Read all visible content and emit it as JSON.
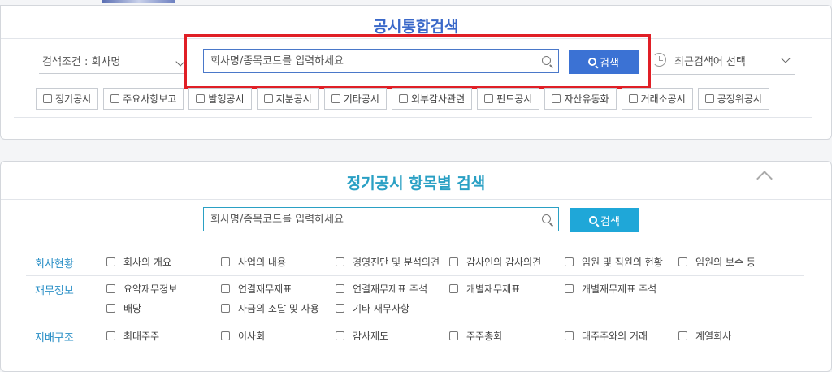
{
  "integrated_search": {
    "title": "공시통합검색",
    "condition_label": "검색조건 : 회사명",
    "search_placeholder": "회사명/종목코드를 입력하세요",
    "search_button": "검색",
    "recent_label": "최근검색어 선택",
    "filters": [
      "정기공시",
      "주요사항보고",
      "발행공시",
      "지분공시",
      "기타공시",
      "외부감사관련",
      "펀드공시",
      "자산유동화",
      "거래소공시",
      "공정위공시"
    ]
  },
  "item_search": {
    "title": "정기공시 항목별 검색",
    "search_placeholder": "회사명/종목코드를 입력하세요",
    "search_button": "검색",
    "categories": [
      {
        "name": "회사현황",
        "items": [
          "회사의 개요",
          "사업의 내용",
          "경영진단 및 분석의견",
          "감사인의 감사의견",
          "임원 및 직원의 현황",
          "임원의 보수 등"
        ]
      },
      {
        "name": "재무정보",
        "items": [
          "요약재무정보",
          "연결재무제표",
          "연결재무제표 주석",
          "개별재무제표",
          "개별재무제표 주석",
          "배당",
          "자금의 조달 및 사용",
          "기타 재무사항"
        ]
      },
      {
        "name": "지배구조",
        "items": [
          "최대주주",
          "이사회",
          "감사제도",
          "주주총회",
          "대주주와의 거래",
          "계열회사"
        ]
      }
    ]
  },
  "colors": {
    "primary_blue": "#3b72d4",
    "teal": "#1fa7d8",
    "highlight_red": "#e01f26"
  }
}
